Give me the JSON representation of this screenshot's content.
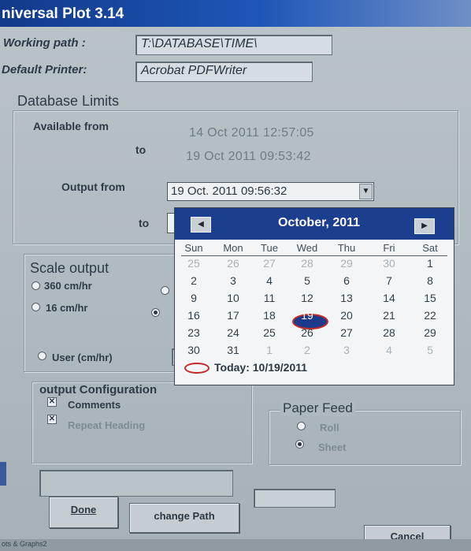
{
  "window": {
    "title": "niversal Plot 3.14"
  },
  "paths": {
    "working_path_label": "Working path :",
    "working_path_value": "T:\\DATABASE\\TIME\\",
    "default_printer_label": "Default Printer:",
    "default_printer_value": "Acrobat PDFWriter"
  },
  "database_limits": {
    "title": "Database Limits",
    "available_from_label": "Available  from",
    "available_from_value": "14 Oct 2011 12:57:05",
    "to_label": "to",
    "available_to_value": "19 Oct 2011 09:53:42",
    "output_from_label": "Output from",
    "output_from_value": "19 Oct. 2011  09:56:32",
    "output_to_label": "to"
  },
  "scale_output": {
    "title": "Scale output",
    "options": [
      {
        "label": "360 cm/hr",
        "selected": false
      },
      {
        "label": "16 cm/hr",
        "selected": false
      },
      {
        "label": "User  (cm/hr)",
        "selected": false
      }
    ]
  },
  "output_configuration": {
    "title": "output Configuration",
    "comments_label": "Comments",
    "comments_checked": true,
    "repeat_heading_label": "Repeat Heading",
    "repeat_heading_checked": true
  },
  "paper_feed": {
    "title": "Paper Feed",
    "roll_label": "Roll",
    "sheet_label": "Sheet",
    "selected": "Sheet"
  },
  "buttons": {
    "done": "Done",
    "change_path": "change Path",
    "cancel": "Cancel"
  },
  "calendar": {
    "month_label": "October, 2011",
    "day_headers": [
      "Sun",
      "Mon",
      "Tue",
      "Wed",
      "Thu",
      "Fri",
      "Sat"
    ],
    "weeks": [
      [
        "25",
        "26",
        "27",
        "28",
        "29",
        "30",
        "1"
      ],
      [
        "2",
        "3",
        "4",
        "5",
        "6",
        "7",
        "8"
      ],
      [
        "9",
        "10",
        "11",
        "12",
        "13",
        "14",
        "15"
      ],
      [
        "16",
        "17",
        "18",
        "19",
        "20",
        "21",
        "22"
      ],
      [
        "23",
        "24",
        "25",
        "26",
        "27",
        "28",
        "29"
      ],
      [
        "30",
        "31",
        "1",
        "2",
        "3",
        "4",
        "5"
      ]
    ],
    "selected_day": "19",
    "today_text": "Today: 10/19/2011"
  },
  "status_bar": {
    "text": "ots & Graphs2"
  },
  "colors": {
    "title_bar": "#1e56b8",
    "selection_ring": "#c42a2a",
    "calendar_header": "#1b3f8e"
  }
}
